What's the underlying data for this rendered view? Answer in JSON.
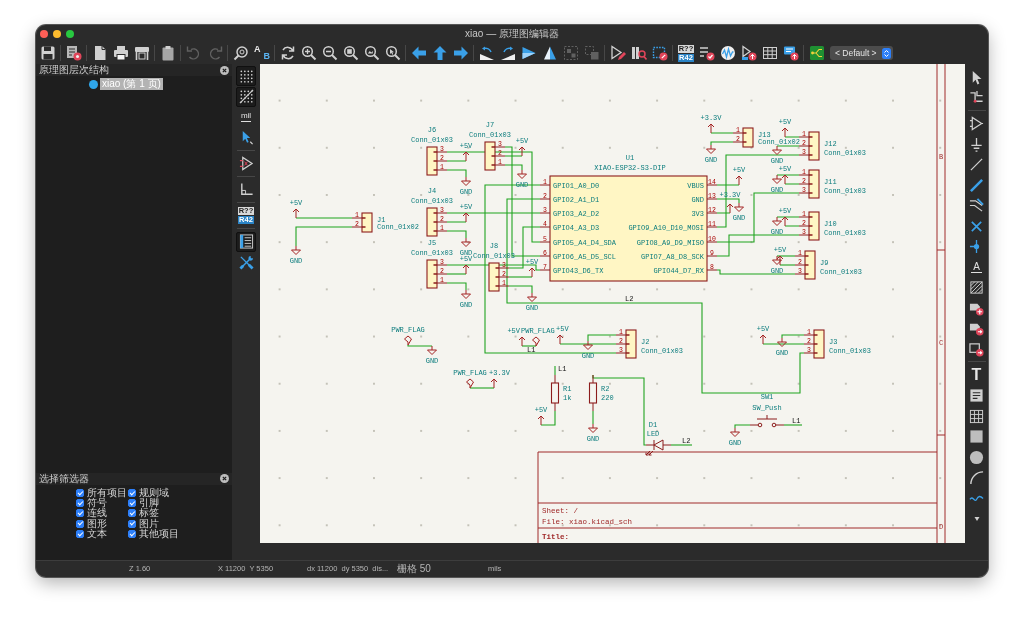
{
  "window": {
    "title": "xiao — 原理图编辑器"
  },
  "toolbar": {
    "groups": [
      [
        {
          "kind": "save",
          "disabled": false
        }
      ],
      [
        {
          "kind": "setup",
          "disabled": false
        }
      ],
      [
        {
          "kind": "new-page",
          "disabled": false
        },
        {
          "kind": "print",
          "disabled": false
        },
        {
          "kind": "plot",
          "disabled": false
        }
      ],
      [
        {
          "kind": "paste",
          "disabled": false
        }
      ],
      [
        {
          "kind": "undo",
          "disabled": true
        },
        {
          "kind": "redo",
          "disabled": true
        }
      ],
      [
        {
          "kind": "find",
          "disabled": false
        },
        {
          "kind": "replace",
          "disabled": false,
          "glyphs": [
            "A",
            "B"
          ]
        }
      ],
      [
        {
          "kind": "refresh",
          "disabled": false
        },
        {
          "kind": "zoom-in",
          "disabled": false
        },
        {
          "kind": "zoom-out",
          "disabled": false
        },
        {
          "kind": "zoom-fit",
          "disabled": false
        },
        {
          "kind": "zoom-objects",
          "disabled": false
        },
        {
          "kind": "zoom-selection",
          "disabled": false
        }
      ],
      [
        {
          "kind": "nav-left",
          "disabled": false
        },
        {
          "kind": "nav-up",
          "disabled": false
        },
        {
          "kind": "nav-right",
          "disabled": false
        }
      ],
      [
        {
          "kind": "rotate-ccw",
          "disabled": false
        },
        {
          "kind": "rotate-cw",
          "disabled": false
        },
        {
          "kind": "mirror-v",
          "disabled": false
        },
        {
          "kind": "mirror-h",
          "disabled": false
        },
        {
          "kind": "group",
          "disabled": true
        },
        {
          "kind": "ungroup",
          "disabled": true
        }
      ],
      [
        {
          "kind": "symbol-editor",
          "disabled": false
        },
        {
          "kind": "library-browser",
          "disabled": false
        },
        {
          "kind": "footprint-assign",
          "disabled": false
        }
      ],
      [
        {
          "kind": "annotate",
          "disabled": false,
          "glyphs": [
            "R??",
            "R42"
          ]
        },
        {
          "kind": "erc",
          "disabled": false
        },
        {
          "kind": "simulator",
          "disabled": false
        },
        {
          "kind": "bom",
          "disabled": false
        },
        {
          "kind": "fields-table",
          "disabled": false
        },
        {
          "kind": "netlist",
          "disabled": false
        }
      ],
      [
        {
          "kind": "pcb",
          "disabled": false
        }
      ]
    ],
    "preset": "< Default >"
  },
  "hierarchy": {
    "title": "原理图层次结构",
    "items": [
      {
        "label": "xiao (第 1 页)",
        "selected": true
      }
    ]
  },
  "selection_filter": {
    "title": "选择筛选器",
    "options": [
      {
        "label": "所有项目",
        "checked": true
      },
      {
        "label": "规则域",
        "checked": true
      },
      {
        "label": "符号",
        "checked": true
      },
      {
        "label": "引脚",
        "checked": true
      },
      {
        "label": "连线",
        "checked": true
      },
      {
        "label": "标签",
        "checked": true
      },
      {
        "label": "图形",
        "checked": true
      },
      {
        "label": "图片",
        "checked": true
      },
      {
        "label": "文本",
        "checked": true
      },
      {
        "label": "其他项目",
        "checked": true
      }
    ]
  },
  "left_toolbar": [
    [
      {
        "kind": "grid",
        "on": true
      },
      {
        "kind": "grid-overrides",
        "on": true
      },
      {
        "kind": "units",
        "on": false,
        "glyph": "mil"
      },
      {
        "kind": "cursor",
        "on": false
      }
    ],
    [
      {
        "kind": "hidden-pins",
        "on": false
      }
    ],
    [
      {
        "kind": "angle",
        "on": false
      }
    ],
    [
      {
        "kind": "annotate",
        "on": false,
        "glyphs": [
          "R??",
          "R42"
        ]
      }
    ],
    [
      {
        "kind": "hierarchy",
        "on": true
      },
      {
        "kind": "tools",
        "on": false
      }
    ]
  ],
  "right_toolbar": [
    [
      {
        "kind": "select"
      },
      {
        "kind": "highlight-net"
      }
    ],
    [
      {
        "kind": "symbol"
      },
      {
        "kind": "power"
      },
      {
        "kind": "wire"
      },
      {
        "kind": "bus"
      },
      {
        "kind": "bus-entry"
      },
      {
        "kind": "no-connect"
      },
      {
        "kind": "junction"
      },
      {
        "kind": "label",
        "glyph": "A"
      },
      {
        "kind": "netclass"
      },
      {
        "kind": "global-label"
      },
      {
        "kind": "hier-label"
      },
      {
        "kind": "hier-sheet"
      }
    ],
    [
      {
        "kind": "text",
        "glyph": "T"
      },
      {
        "kind": "textbox"
      },
      {
        "kind": "table"
      },
      {
        "kind": "rect"
      },
      {
        "kind": "circle"
      },
      {
        "kind": "arc"
      },
      {
        "kind": "bezier"
      },
      {
        "kind": "more"
      }
    ]
  ],
  "schematic": {
    "symbols": [
      {
        "kind": "connector",
        "ref": "J6",
        "value": "Conn_01x03",
        "pins": [
          "3",
          "2",
          "1"
        ]
      },
      {
        "kind": "connector",
        "ref": "J7",
        "value": "Conn_01x03",
        "pins": [
          "3",
          "2",
          "1"
        ]
      },
      {
        "kind": "connector",
        "ref": "J13",
        "value": "Conn_01x02",
        "pins": [
          "1",
          "2"
        ]
      },
      {
        "kind": "connector",
        "ref": "J12",
        "value": "Conn_01x03",
        "pins": [
          "1",
          "2",
          "3"
        ]
      },
      {
        "kind": "ic",
        "ref": "U1",
        "value": "XIAO-ESP32-S3-DIP",
        "left_pins": [
          {
            "number": "1",
            "name": "GPIO1_A0_D0"
          },
          {
            "number": "2",
            "name": "GPIO2_A1_D1"
          },
          {
            "number": "3",
            "name": "GPIO3_A2_D2"
          },
          {
            "number": "4",
            "name": "GPIO4_A3_D3"
          },
          {
            "number": "5",
            "name": "GPIO5_A4_D4_SDA"
          },
          {
            "number": "6",
            "name": "GPIO6_A5_D5_SCL"
          },
          {
            "number": "7",
            "name": "GPIO43_D6_TX"
          }
        ],
        "right_pins": [
          {
            "number": "14",
            "name": "VBUS"
          },
          {
            "number": "13",
            "name": "GND"
          },
          {
            "number": "12",
            "name": "3V3"
          },
          {
            "number": "11",
            "name": "GPIO9_A10_D10_MOSI"
          },
          {
            "number": "10",
            "name": "GPIO8_A9_D9_MISO"
          },
          {
            "number": "9",
            "name": "GPIO7_A8_D8_SCK"
          },
          {
            "number": "8",
            "name": "GPIO44_D7_RX"
          }
        ]
      },
      {
        "kind": "connector",
        "ref": "J11",
        "value": "Conn_01x03",
        "pins": [
          "1",
          "2",
          "3"
        ]
      },
      {
        "kind": "connector",
        "ref": "J4",
        "value": "Conn_01x03",
        "pins": [
          "3",
          "2",
          "1"
        ]
      },
      {
        "kind": "connector",
        "ref": "J1",
        "value": "Conn_01x02",
        "pins": [
          "1",
          "2"
        ]
      },
      {
        "kind": "connector",
        "ref": "J10",
        "value": "Conn_01x03",
        "pins": [
          "1",
          "2",
          "3"
        ]
      },
      {
        "kind": "connector",
        "ref": "J5",
        "value": "Conn_01x03",
        "pins": [
          "3",
          "2",
          "1"
        ]
      },
      {
        "kind": "connector",
        "ref": "J8",
        "value": "Conn_01x03",
        "pins": [
          "3",
          "2",
          "1"
        ]
      },
      {
        "kind": "connector",
        "ref": "J9",
        "value": "Conn_01x03",
        "pins": [
          "1",
          "2",
          "3"
        ]
      },
      {
        "kind": "connector",
        "ref": "J2",
        "value": "Conn_01x03",
        "pins": [
          "1",
          "2",
          "3"
        ]
      },
      {
        "kind": "connector",
        "ref": "J3",
        "value": "Conn_01x03",
        "pins": [
          "1",
          "2",
          "3"
        ]
      },
      {
        "kind": "resistor",
        "ref": "R1",
        "value": "1k"
      },
      {
        "kind": "resistor",
        "ref": "R2",
        "value": "220"
      },
      {
        "kind": "switch",
        "ref": "SW1",
        "value": "SW_Push"
      },
      {
        "kind": "led",
        "ref": "D1",
        "value": "LED"
      }
    ],
    "power": [
      {
        "kind": "vcc",
        "label": "+5V"
      },
      {
        "kind": "gnd",
        "label": "GND"
      },
      {
        "kind": "vcc",
        "label": "+5V"
      },
      {
        "kind": "gnd",
        "label": "GND"
      },
      {
        "kind": "vcc",
        "label": "+5V"
      },
      {
        "kind": "gnd",
        "label": "GND"
      },
      {
        "kind": "vcc",
        "label": "+5V"
      },
      {
        "kind": "gnd",
        "label": "GND"
      },
      {
        "kind": "vcc",
        "label": "+5V"
      },
      {
        "kind": "gnd",
        "label": "GND"
      },
      {
        "kind": "vcc",
        "label": "+5V"
      },
      {
        "kind": "gnd",
        "label": "GND"
      },
      {
        "kind": "flag",
        "label": "PWR_FLAG"
      },
      {
        "kind": "gnd",
        "label": "GND"
      },
      {
        "kind": "flag",
        "label": "PWR_FLAG"
      },
      {
        "kind": "vcc",
        "label": "+3.3V"
      },
      {
        "kind": "vcc",
        "label": "+5V"
      },
      {
        "kind": "flag",
        "label": "PWR_FLAG"
      },
      {
        "kind": "vcc",
        "label": "+5V"
      },
      {
        "kind": "gnd",
        "label": "GND"
      },
      {
        "kind": "vcc",
        "label": "+5V"
      },
      {
        "kind": "gnd",
        "label": "GND"
      },
      {
        "kind": "gnd",
        "label": "GND"
      },
      {
        "kind": "vcc",
        "label": "+3.3V"
      },
      {
        "kind": "gnd",
        "label": "GND"
      },
      {
        "kind": "vcc",
        "label": "+5V"
      },
      {
        "kind": "vcc",
        "label": "+3.3V"
      },
      {
        "kind": "gnd",
        "label": "GND"
      },
      {
        "kind": "vcc",
        "label": "+5V"
      },
      {
        "kind": "gnd",
        "label": "GND"
      },
      {
        "kind": "vcc",
        "label": "+5V"
      },
      {
        "kind": "gnd",
        "label": "GND"
      },
      {
        "kind": "vcc",
        "label": "+5V"
      },
      {
        "kind": "gnd",
        "label": "GND"
      },
      {
        "kind": "vcc",
        "label": "+5V"
      },
      {
        "kind": "gnd",
        "label": "GND"
      },
      {
        "kind": "vcc",
        "label": "+5V"
      },
      {
        "kind": "gnd",
        "label": "GND"
      }
    ],
    "net_labels": [
      {
        "label": "L2"
      },
      {
        "label": "L1"
      },
      {
        "label": "L1"
      },
      {
        "label": "L1"
      },
      {
        "label": "L2"
      }
    ],
    "frame_rows": [
      "B",
      "C",
      "D"
    ],
    "title_block": {
      "sheet": "Sheet: /",
      "file": "File: xiao.kicad_sch",
      "title": "Title:"
    }
  },
  "status_bar": {
    "zoom": "Z 1.60",
    "cursor": "X 11200  Y 5350",
    "delta": "dx 11200  dy 5350  dis...",
    "grid": "栅格 50",
    "units": "mils"
  }
}
